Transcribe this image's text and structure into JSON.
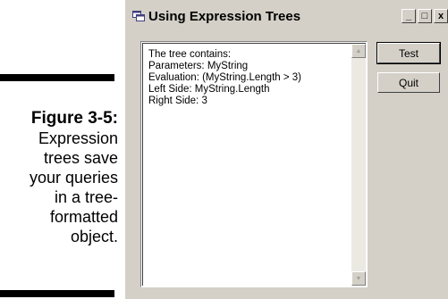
{
  "caption": {
    "figure_label": "Figure 3-5:",
    "lines": [
      "Expression",
      "trees save",
      "your queries",
      "in a tree-",
      "formatted",
      "object."
    ]
  },
  "window": {
    "title": "Using Expression Trees",
    "controls": {
      "minimize": "_",
      "maximize": "□",
      "close": "x"
    }
  },
  "output": {
    "lines": [
      "The tree contains:",
      "Parameters: MyString",
      "Evaluation: (MyString.Length > 3)",
      "Left Side: MyString.Length",
      "Right Side: 3"
    ]
  },
  "buttons": {
    "test": "Test",
    "quit": "Quit"
  },
  "icons": {
    "app": "app-window-icon",
    "scroll_up": "scroll-up-icon",
    "scroll_down": "scroll-down-icon"
  }
}
